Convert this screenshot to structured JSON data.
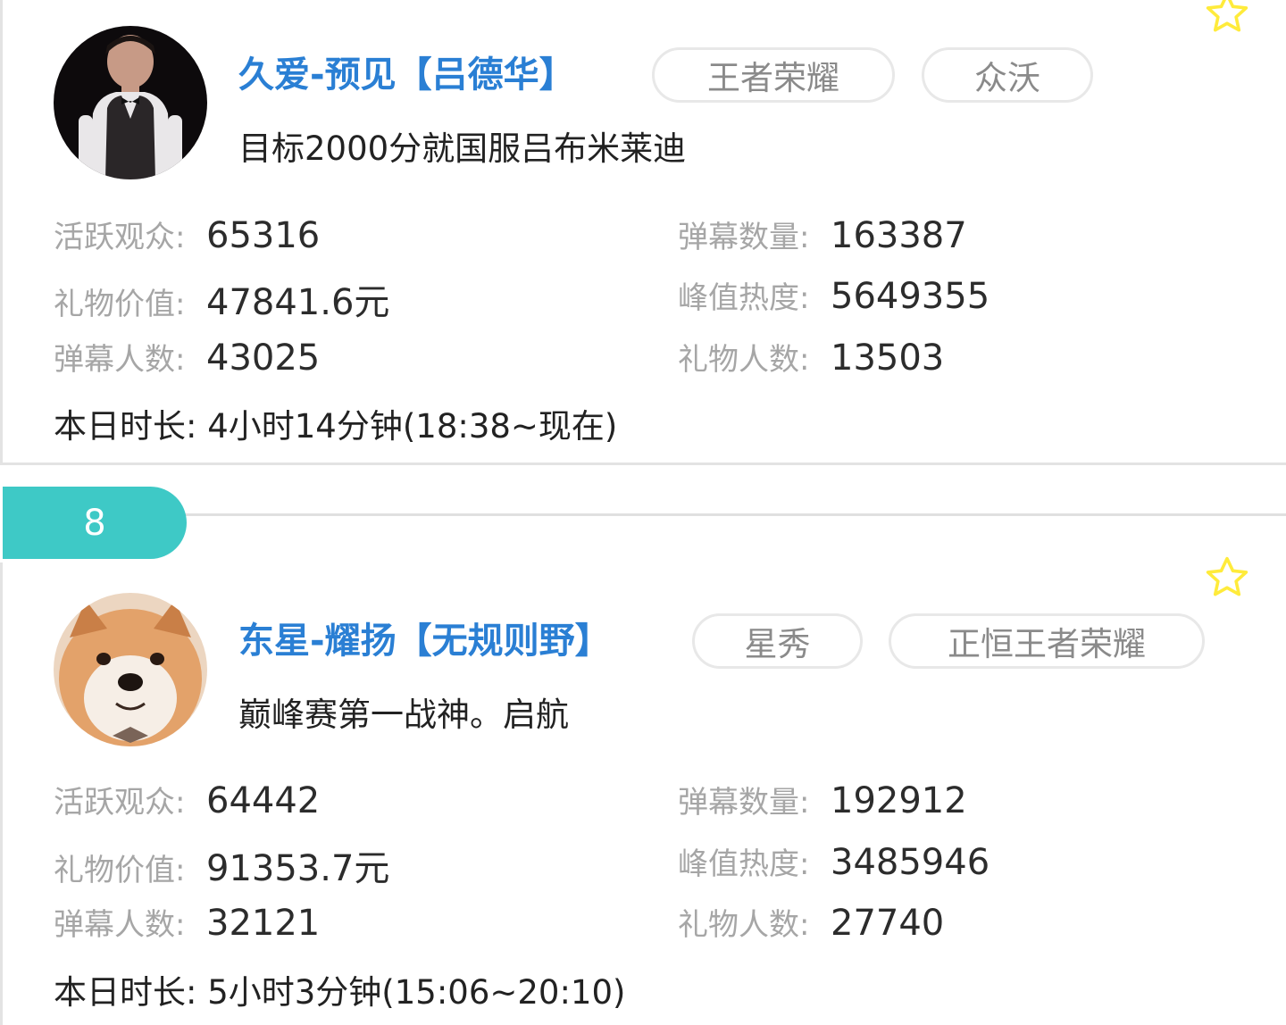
{
  "colors": {
    "name": "#2a7fd4",
    "label": "#a6a6a6",
    "value": "#2c2c2c",
    "tag_border": "#e8e8e8",
    "rank_badge": "#3ec9c6",
    "star": "#ffeb3b"
  },
  "cards": [
    {
      "name": "久爱-预见【吕德华】",
      "tags": [
        "王者荣耀",
        "众沃"
      ],
      "room_title": "目标2000分就国服吕布米莱迪",
      "favorite_icon": "star-outline-icon",
      "stats": {
        "active_viewers": {
          "label": "活跃观众:",
          "value": "65316"
        },
        "danmaku_count": {
          "label": "弹幕数量:",
          "value": "163387"
        },
        "gift_value": {
          "label": "礼物价值:",
          "value": "47841.6元"
        },
        "peak_heat": {
          "label": "峰值热度:",
          "value": "5649355"
        },
        "danmaku_users": {
          "label": "弹幕人数:",
          "value": "43025"
        },
        "gift_users": {
          "label": "礼物人数:",
          "value": "13503"
        }
      },
      "duration": "本日时长:  4小时14分钟(18:38~现在)"
    },
    {
      "rank": "8",
      "name": "东星-耀扬【无规则野】",
      "tags": [
        "星秀",
        "正恒王者荣耀"
      ],
      "room_title": "巅峰赛第一战神。启航",
      "favorite_icon": "star-outline-icon",
      "stats": {
        "active_viewers": {
          "label": "活跃观众:",
          "value": "64442"
        },
        "danmaku_count": {
          "label": "弹幕数量:",
          "value": "192912"
        },
        "gift_value": {
          "label": "礼物价值:",
          "value": "91353.7元"
        },
        "peak_heat": {
          "label": "峰值热度:",
          "value": "3485946"
        },
        "danmaku_users": {
          "label": "弹幕人数:",
          "value": "32121"
        },
        "gift_users": {
          "label": "礼物人数:",
          "value": "27740"
        }
      },
      "duration": "本日时长:  5小时3分钟(15:06~20:10)"
    }
  ]
}
